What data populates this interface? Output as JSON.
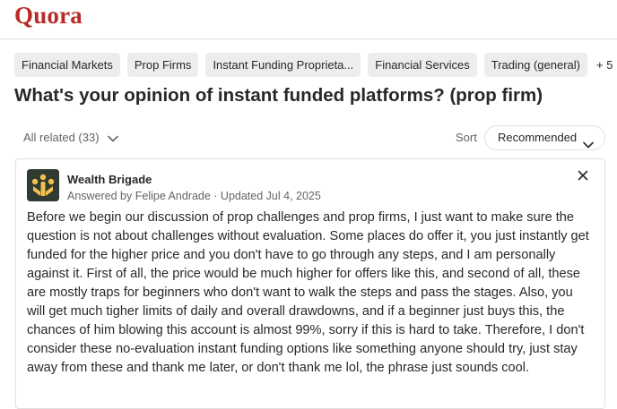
{
  "header": {
    "logo_text": "Quora",
    "brand_color": "#b92b27"
  },
  "topics": [
    "Financial Markets",
    "Prop Firms",
    "Instant Funding Proprieta...",
    "Financial Services",
    "Trading (general)"
  ],
  "topics_more": "+ 5",
  "question": {
    "title": "What's your opinion of instant funded platforms? (prop firm)"
  },
  "filters": {
    "all_related": "All related (33)",
    "sort_label": "Sort",
    "sort_value": "Recommended"
  },
  "answer": {
    "author": "Wealth Brigade",
    "meta": "Answered by Felipe Andrade · Updated Jul 4, 2025",
    "body": "Before we begin our discussion of prop challenges and prop firms, I just want to make sure the question is not about challenges without evaluation. Some places do offer it, you just instantly get funded for the higher price and you don't have to go through any steps, and I am personally against it. First of all, the price would be much higher for offers like this, and second of all, these are mostly traps for beginners who don't want to walk the steps and pass the stages. Also, you will get much tigher limits of daily and overall drawdowns, and if a beginner just buys this, the chances of him blowing this account is almost 99%, sorry if this is hard to take. Therefore, I don't consider these no-evaluation instant funding options like something anyone should try, just stay away from these and thank me later, or don't thank me lol, the phrase just sounds cool.",
    "avatar_icon": "wealth-brigade-logo",
    "avatar_colors": {
      "background": "#2f3a30",
      "mark": "#f2c14e"
    }
  },
  "icons": {
    "chevron": "chevron-down-icon",
    "close": "close-icon"
  }
}
